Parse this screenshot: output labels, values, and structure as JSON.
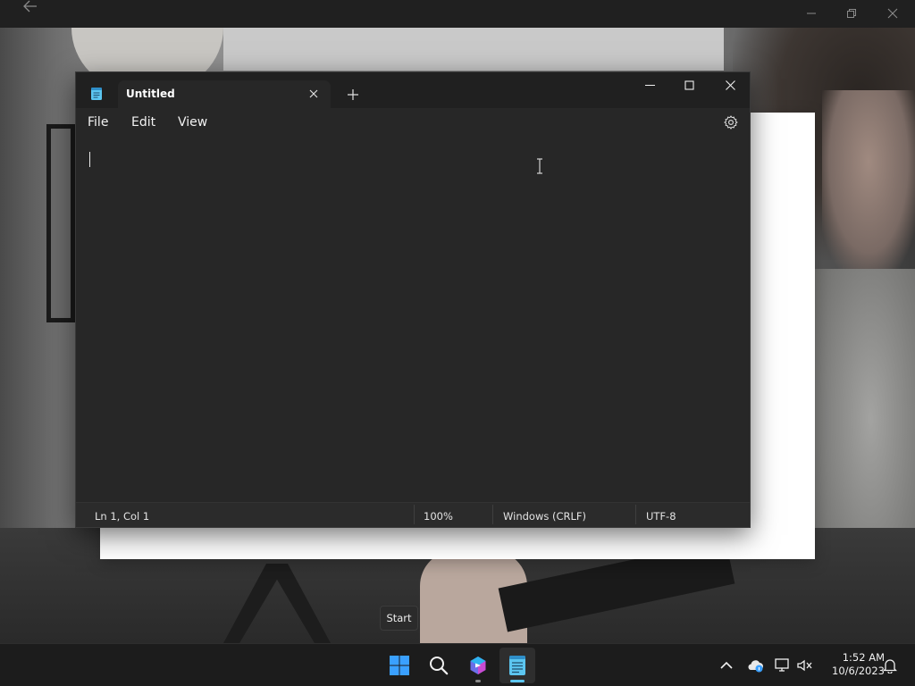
{
  "notepad": {
    "tab_title": "Untitled",
    "menu": {
      "file": "File",
      "edit": "Edit",
      "view": "View"
    },
    "status": {
      "position": "Ln 1, Col 1",
      "zoom": "100%",
      "line_ending": "Windows (CRLF)",
      "encoding": "UTF-8"
    }
  },
  "tooltip": {
    "text": "Start"
  },
  "taskbar": {
    "pinned": [
      "windows-start-icon",
      "search-icon",
      "copilot-icon",
      "notepad-icon"
    ],
    "time": "1:52 AM",
    "date": "10/6/2023"
  },
  "colors": {
    "taskbar_bg": "#1c1c1c",
    "notepad_bg": "#272727",
    "windows_blue": "#3aa0ff",
    "notepad_accent": "#5cc6f0"
  }
}
